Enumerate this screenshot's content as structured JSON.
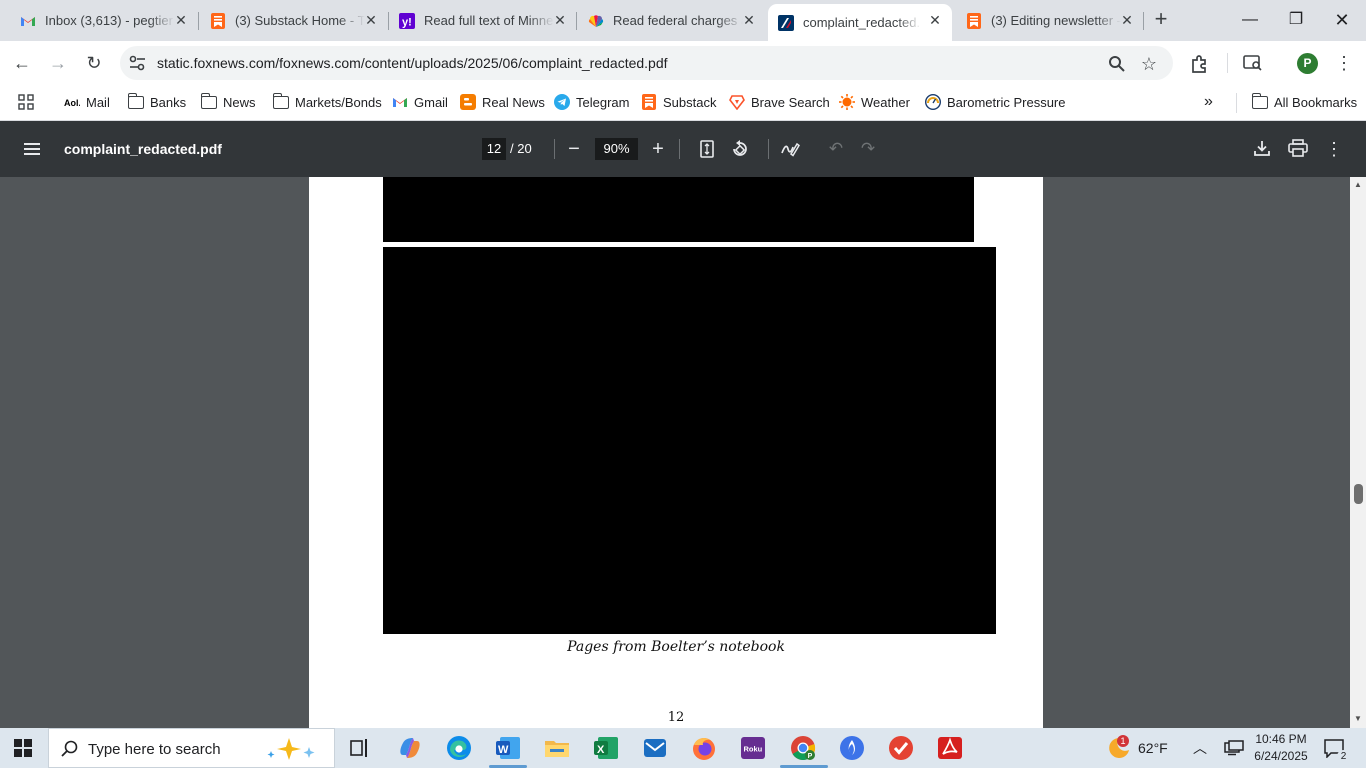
{
  "tabs": [
    {
      "title": "Inbox (3,613) - pegtier",
      "icon": "gmail-icon",
      "active": false
    },
    {
      "title": "(3) Substack Home - T",
      "icon": "substack-icon",
      "active": false
    },
    {
      "title": "Read full text of Minne",
      "icon": "yahoo-icon",
      "active": false
    },
    {
      "title": "Read federal charges a",
      "icon": "nbc-icon",
      "active": false
    },
    {
      "title": "complaint_redacted.pdf",
      "icon": "foxnews-icon",
      "active": true
    },
    {
      "title": "(3) Editing newsletter -",
      "icon": "substack-icon",
      "active": false
    }
  ],
  "toolbar": {
    "url": "static.foxnews.com/foxnews.com/content/uploads/2025/06/complaint_redacted.pdf",
    "profile_initial": "P"
  },
  "bookmarks": [
    {
      "label": "Mail",
      "icon": "aol-icon"
    },
    {
      "label": "Banks",
      "icon": "folder-icon"
    },
    {
      "label": "News",
      "icon": "folder-icon"
    },
    {
      "label": "Markets/Bonds",
      "icon": "folder-icon"
    },
    {
      "label": "Gmail",
      "icon": "gmail-icon"
    },
    {
      "label": "Real News",
      "icon": "blogger-icon"
    },
    {
      "label": "Telegram",
      "icon": "telegram-icon"
    },
    {
      "label": "Substack",
      "icon": "substack-icon"
    },
    {
      "label": "Brave Search",
      "icon": "brave-icon"
    },
    {
      "label": "Weather",
      "icon": "weather-icon"
    },
    {
      "label": "Barometric Pressure",
      "icon": "barometer-icon"
    }
  ],
  "all_bookmarks": "All Bookmarks",
  "pdf": {
    "filename": "complaint_redacted.pdf",
    "current_page": "12",
    "total_pages": "/ 20",
    "zoom": "90%",
    "caption": "Pages from Boelter’s notebook",
    "page_number": "12"
  },
  "taskbar": {
    "search_placeholder": "Type here to search",
    "weather_temp": "62°F",
    "weather_badge": "1",
    "time": "10:46 PM",
    "date": "6/24/2025",
    "notification_count": "2"
  },
  "colors": {
    "tabstrip": "#dee1e6",
    "pdf_toolbar": "#323639",
    "viewer_bg": "#525659",
    "taskbar": "#dde6ee"
  }
}
